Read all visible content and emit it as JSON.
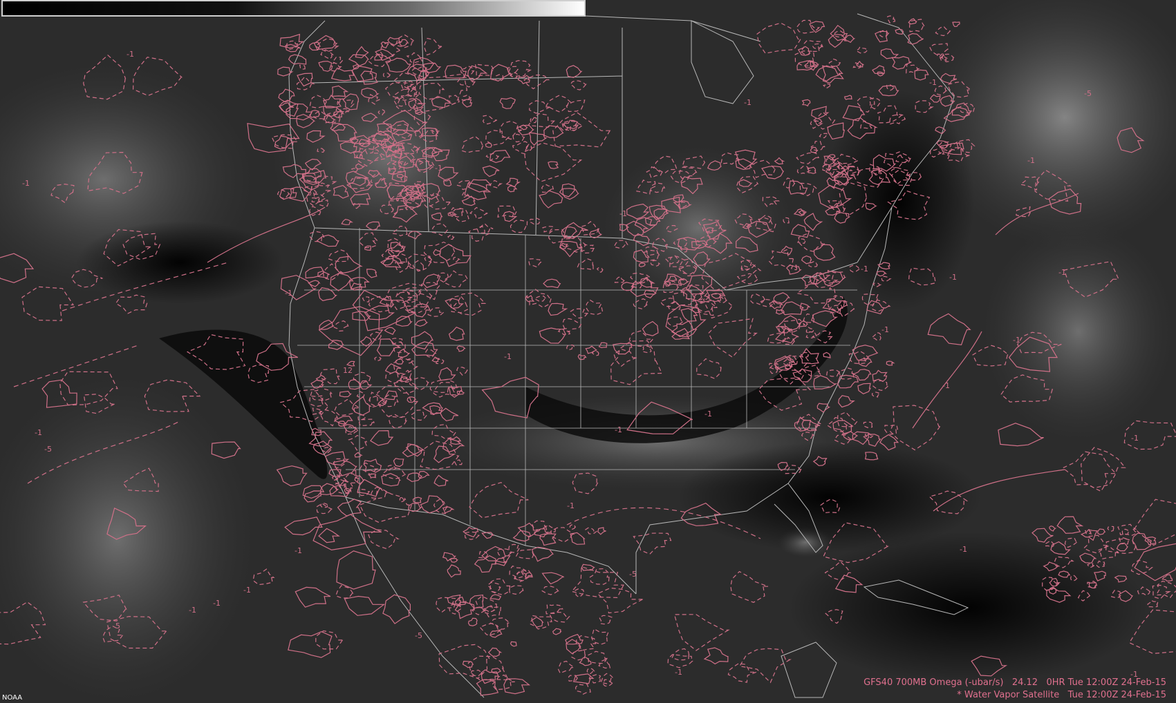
{
  "colors": {
    "contour": "#d07088",
    "border": "#b8b8b8",
    "legend_text": "#e0708e",
    "background": "#000000"
  },
  "legend": {
    "line1": "GFS40 700MB Omega (-ubar/s)   24.12   0HR Tue 12:00Z 24-Feb-15",
    "line2": "* Water Vapor Satellite   Tue 12:00Z 24-Feb-15"
  },
  "credit": "NOAA",
  "contour_labels": [
    "-1",
    "-1",
    "-1",
    "-1",
    "-5",
    "-1",
    "-1",
    "-1",
    "-5",
    "-1",
    "-1",
    "-1",
    "5",
    "-1",
    "-1",
    "-1",
    "-5",
    "-1",
    "-1",
    "-1",
    "-1",
    "-1",
    "12",
    "-1",
    "-1",
    "-5",
    "-1",
    "-1",
    "-1",
    "-1",
    "-1",
    "-1",
    "-1",
    "-1"
  ]
}
